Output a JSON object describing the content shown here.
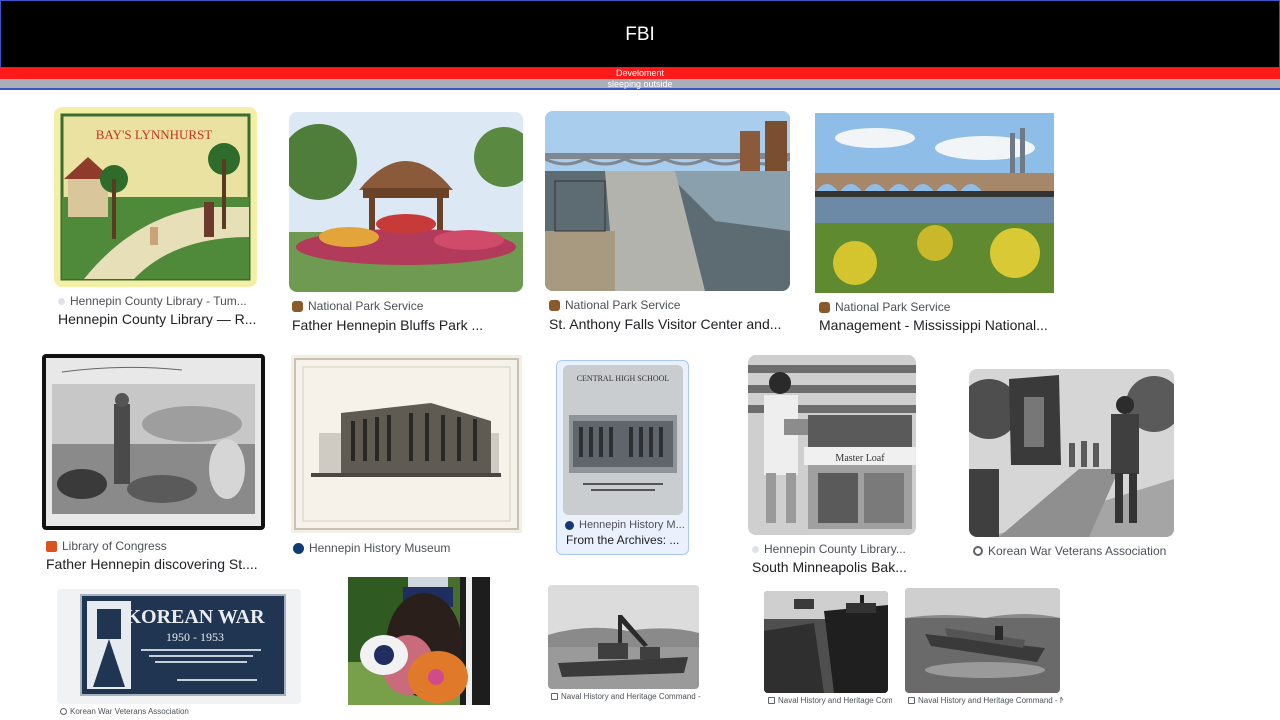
{
  "header": {
    "title": "FBI",
    "red_label": "Develoment",
    "grey_label": "sleeping outside"
  },
  "results": [
    {
      "source": "Hennepin County Library - Tum...",
      "caption": "Hennepin County Library — R...",
      "icon": "library-icon"
    },
    {
      "source": "National Park Service",
      "caption": "Father Hennepin Bluffs Park ...",
      "icon": "nps-icon"
    },
    {
      "source": "National Park Service",
      "caption": "St. Anthony Falls Visitor Center and...",
      "icon": "nps-icon"
    },
    {
      "source": "National Park Service",
      "caption": "Management - Mississippi National...",
      "icon": "nps-icon"
    },
    {
      "source": "Library of Congress",
      "caption": "Father Hennepin discovering St....",
      "icon": "loc-icon"
    },
    {
      "source": "Hennepin History Museum",
      "caption": "",
      "icon": "museum-icon"
    },
    {
      "source": "Hennepin History M...",
      "caption": "From the Archives: ...",
      "icon": "museum-icon"
    },
    {
      "source": "Hennepin County Library...",
      "caption": "South Minneapolis Bak...",
      "icon": "library-icon"
    },
    {
      "source": "Korean War Veterans Association",
      "caption": "",
      "icon": "globe-icon"
    },
    {
      "source": "Korean War Veterans Association",
      "caption": "",
      "icon": "globe-icon"
    },
    {
      "source": "",
      "caption": "",
      "icon": ""
    },
    {
      "source": "Naval History and Heritage Command - N...",
      "caption": "",
      "icon": "anchor-icon"
    },
    {
      "source": "Naval History and Heritage Comm...",
      "caption": "",
      "icon": "anchor-icon"
    },
    {
      "source": "Naval History and Heritage Command - Na...",
      "caption": "",
      "icon": "anchor-icon"
    }
  ],
  "image_text": {
    "lynnhurst": "BAY'S LYNNHURST",
    "central_high": "CENTRAL HIGH SCHOOL",
    "korean_war": "KOREAN WAR",
    "korean_years": "1950 - 1953",
    "master_loaf": "Master Loaf"
  },
  "colors": {
    "header_bg": "#000000",
    "red_bar": "#ff1a1a",
    "grey_bar": "#a9aeb9",
    "selected_bg": "#eaf1fd"
  }
}
